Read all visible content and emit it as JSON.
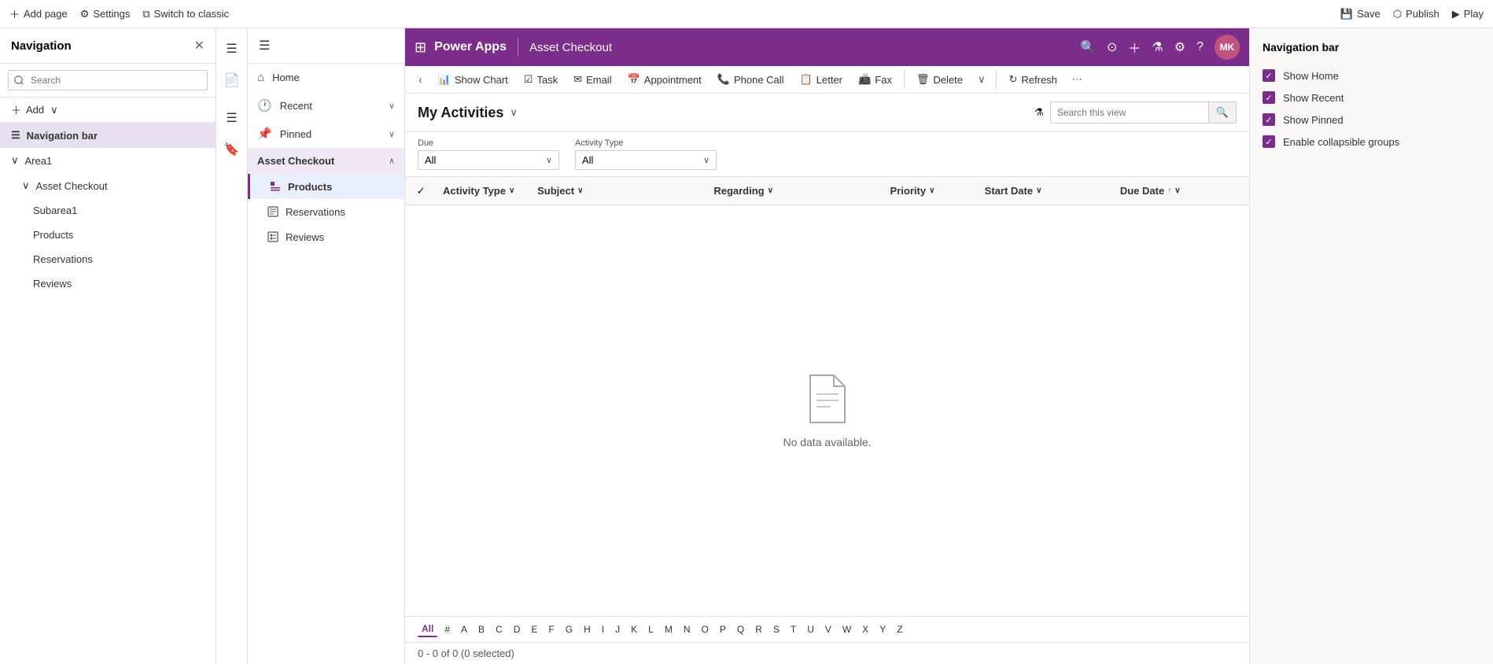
{
  "topbar": {
    "add_page": "Add page",
    "settings": "Settings",
    "switch_classic": "Switch to classic",
    "save": "Save",
    "publish": "Publish",
    "play": "Play"
  },
  "nav_panel": {
    "title": "Navigation",
    "search_placeholder": "Search",
    "add_label": "Add",
    "area1": "Area1",
    "asset_checkout": "Asset Checkout",
    "subarea1": "Subarea1",
    "products": "Products",
    "reservations": "Reservations",
    "reviews": "Reviews"
  },
  "side_nav": {
    "home": "Home",
    "recent": "Recent",
    "pinned": "Pinned",
    "asset_checkout": "Asset Checkout",
    "products": "Products",
    "reservations": "Reservations",
    "reviews": "Reviews"
  },
  "pa_header": {
    "app_icon": "⊞",
    "brand": "Power Apps",
    "app_name": "Asset Checkout",
    "avatar": "MK"
  },
  "toolbar": {
    "back": "‹",
    "show_chart": "Show Chart",
    "task": "Task",
    "email": "Email",
    "appointment": "Appointment",
    "phone_call": "Phone Call",
    "letter": "Letter",
    "fax": "Fax",
    "delete": "Delete",
    "refresh": "Refresh"
  },
  "view": {
    "title": "My Activities",
    "search_placeholder": "Search this view",
    "filter_label_due": "Due",
    "filter_label_activity_type": "Activity Type",
    "filter_due_value": "All",
    "filter_activity_value": "All"
  },
  "table": {
    "col_activity_type": "Activity Type",
    "col_subject": "Subject",
    "col_regarding": "Regarding",
    "col_priority": "Priority",
    "col_start_date": "Start Date",
    "col_due_date": "Due Date"
  },
  "empty_state": {
    "text": "No data available."
  },
  "alpha_nav": {
    "letters": [
      "All",
      "#",
      "A",
      "B",
      "C",
      "D",
      "E",
      "F",
      "G",
      "H",
      "I",
      "J",
      "K",
      "L",
      "M",
      "N",
      "O",
      "P",
      "Q",
      "R",
      "S",
      "T",
      "U",
      "V",
      "W",
      "X",
      "Y",
      "Z"
    ]
  },
  "footer": {
    "text": "0 - 0 of 0 (0 selected)"
  },
  "right_panel": {
    "title": "Navigation bar",
    "items": [
      {
        "label": "Show Home",
        "checked": true
      },
      {
        "label": "Show Recent",
        "checked": true
      },
      {
        "label": "Show Pinned",
        "checked": true
      },
      {
        "label": "Enable collapsible groups",
        "checked": true
      }
    ]
  }
}
